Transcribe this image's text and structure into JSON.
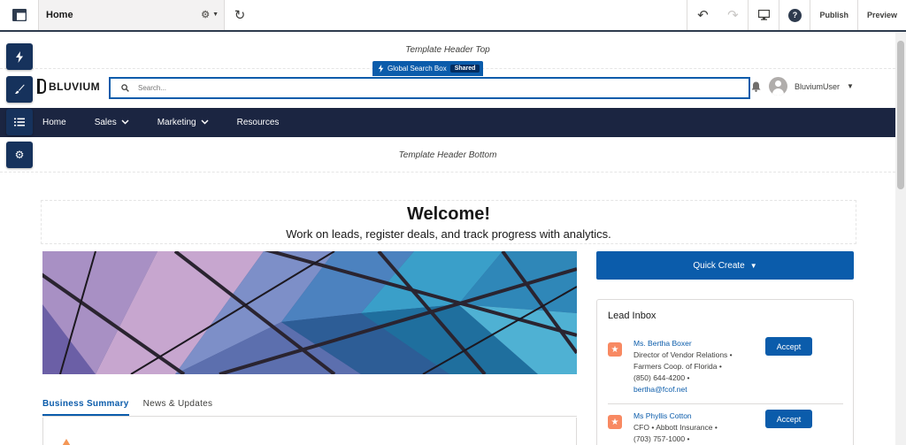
{
  "builder": {
    "page_name": "Home",
    "publish": "Publish",
    "preview": "Preview",
    "help": "?"
  },
  "palette": {
    "icons": [
      "lightning-icon",
      "paintbrush-icon",
      "list-icon",
      "gear-icon"
    ]
  },
  "template": {
    "header_top": "Template Header Top",
    "header_bottom": "Template Header Bottom",
    "global_search_badge": "Global Search Box",
    "shared_label": "Shared"
  },
  "site_header": {
    "logo_text": "BLUVIUM",
    "search_placeholder": "Search...",
    "user_name": "BluviumUser"
  },
  "nav": {
    "items": [
      {
        "label": "Home",
        "has_menu": false
      },
      {
        "label": "Sales",
        "has_menu": true
      },
      {
        "label": "Marketing",
        "has_menu": true
      },
      {
        "label": "Resources",
        "has_menu": false
      }
    ]
  },
  "welcome": {
    "title": "Welcome!",
    "subtitle": "Work on leads, register deals, and track progress with analytics."
  },
  "tabs": [
    {
      "label": "Business Summary",
      "active": true
    },
    {
      "label": "News & Updates",
      "active": false
    }
  ],
  "quick_create": {
    "label": "Quick Create"
  },
  "lead_inbox": {
    "title": "Lead Inbox",
    "accept_label": "Accept",
    "leads": [
      {
        "name": "Ms. Bertha Boxer",
        "title": "Director of Vendor Relations",
        "company": "Farmers Coop. of Florida",
        "phone": "(850) 644-4200",
        "email": "bertha@fcof.net"
      },
      {
        "name": "Ms Phyllis Cotton",
        "title": "CFO",
        "company": "Abbott Insurance",
        "phone": "(703) 757-1000"
      }
    ]
  },
  "colors": {
    "brand_blue": "#0b5cab",
    "nav_bg": "#1b2541",
    "palette_bg": "#16325c",
    "lead_icon": "#f88962"
  }
}
